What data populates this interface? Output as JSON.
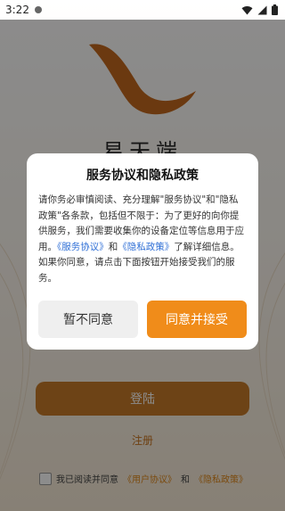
{
  "status_bar": {
    "time": "3:22"
  },
  "app": {
    "name": "易天端"
  },
  "login": {
    "button_label": "登陆",
    "register_label": "注册"
  },
  "agreement": {
    "prefix": "我已阅读并同意",
    "user_agreement": "《用户协议》",
    "and": "和",
    "privacy_policy": "《隐私政策》"
  },
  "dialog": {
    "title": "服务协议和隐私政策",
    "body_part1": "请你务必审慎阅读、充分理解\"服务协议\"和\"隐私政策\"各条款，包括但不限于：为了更好的向你提供服务，我们需要收集你的设备定位等信息用于应用。",
    "link_service": "《服务协议》",
    "and": "和",
    "link_privacy": "《隐私政策》",
    "body_part2": "了解详细信息。如果你同意，请点击下面按钮开始接受我们的服务。",
    "disagree_label": "暂不同意",
    "agree_label": "同意并接受"
  },
  "colors": {
    "accent_orange": "#f08c1a",
    "login_brown": "#c77b28",
    "link_blue": "#2f6fd6"
  }
}
